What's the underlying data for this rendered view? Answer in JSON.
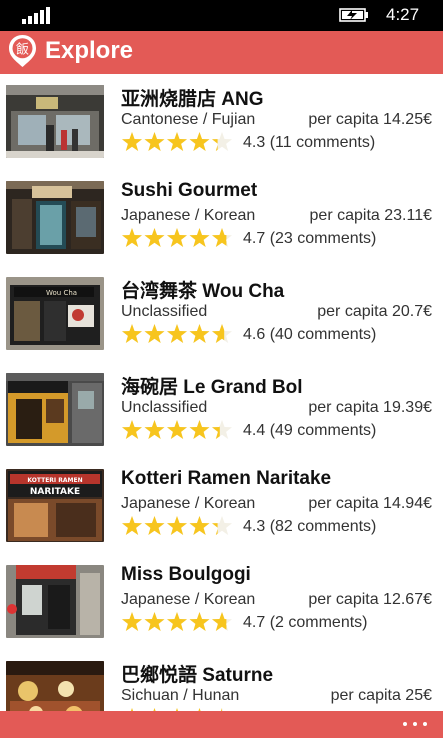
{
  "status": {
    "time": "4:27"
  },
  "app": {
    "title": "Explore",
    "brand_color": "#e35a56",
    "logo_glyph": "飯"
  },
  "star_color": "#f7c51e",
  "restaurants": [
    {
      "name": "亚洲烧腊店 ANG",
      "cuisine": "Cantonese / Fujian",
      "price": "per capita 14.25€",
      "stars": 4.3,
      "rating": "4.3 (11 comments)"
    },
    {
      "name": "Sushi Gourmet",
      "cuisine": "Japanese / Korean",
      "price": "per capita 23.11€",
      "stars": 4.7,
      "rating": "4.7 (23 comments)"
    },
    {
      "name": "台湾舞茶 Wou Cha",
      "cuisine": "Unclassified",
      "price": "per capita 20.7€",
      "stars": 4.6,
      "rating": "4.6 (40 comments)"
    },
    {
      "name": "海碗居 Le Grand Bol",
      "cuisine": "Unclassified",
      "price": "per capita 19.39€",
      "stars": 4.4,
      "rating": "4.4 (49 comments)"
    },
    {
      "name": "Kotteri Ramen Naritake",
      "cuisine": "Japanese / Korean",
      "price": "per capita 14.94€",
      "stars": 4.3,
      "rating": "4.3 (82 comments)"
    },
    {
      "name": "Miss Boulgogi",
      "cuisine": "Japanese / Korean",
      "price": "per capita 12.67€",
      "stars": 4.7,
      "rating": "4.7 (2 comments)"
    },
    {
      "name": "巴鄉悦語 Saturne",
      "cuisine": "Sichuan / Hunan",
      "price": "per capita 25€",
      "stars": 4.5,
      "rating": ""
    }
  ],
  "thumbs": [
    {
      "icon": "storefront-photo",
      "sign_text": "aNG"
    },
    {
      "icon": "storefront-photo",
      "sign_text": ""
    },
    {
      "icon": "storefront-photo",
      "sign_text": "Wou Cha"
    },
    {
      "icon": "storefront-photo",
      "sign_text": ""
    },
    {
      "icon": "storefront-photo",
      "sign_text": "KOTTERI RAMEN NARITAKE"
    },
    {
      "icon": "storefront-photo",
      "sign_text": ""
    },
    {
      "icon": "storefront-photo",
      "sign_text": ""
    }
  ],
  "appbar_more_icon": "ellipsis-icon"
}
